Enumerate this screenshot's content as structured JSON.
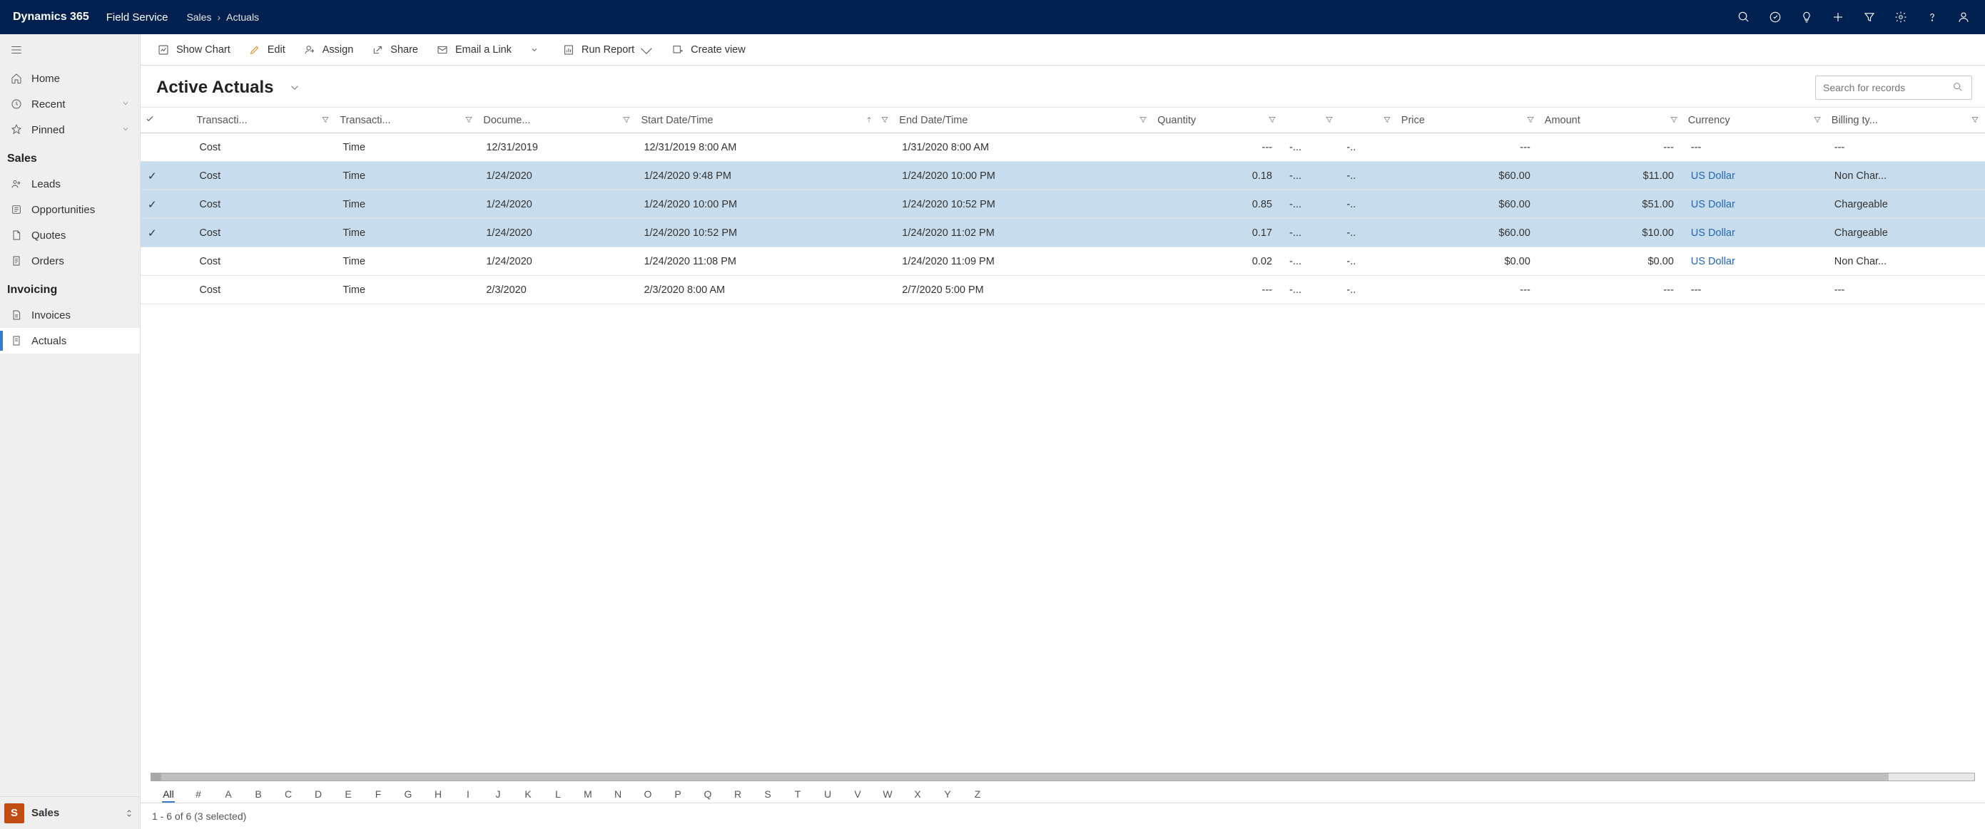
{
  "top": {
    "brand": "Dynamics 365",
    "module": "Field Service",
    "crumb1": "Sales",
    "crumb2": "Actuals"
  },
  "nav": {
    "items": [
      {
        "label": "Home",
        "icon": "home-icon"
      },
      {
        "label": "Recent",
        "icon": "clock-icon",
        "expandable": true
      },
      {
        "label": "Pinned",
        "icon": "pin-icon",
        "expandable": true
      }
    ],
    "section_sales": "Sales",
    "sales_items": [
      {
        "label": "Leads",
        "icon": "leads-icon"
      },
      {
        "label": "Opportunities",
        "icon": "opportunity-icon"
      },
      {
        "label": "Quotes",
        "icon": "quote-icon"
      },
      {
        "label": "Orders",
        "icon": "order-icon"
      }
    ],
    "section_invoicing": "Invoicing",
    "inv_items": [
      {
        "label": "Invoices",
        "icon": "invoice-icon"
      },
      {
        "label": "Actuals",
        "icon": "actuals-icon",
        "active": true
      }
    ],
    "footer_initial": "S",
    "footer_label": "Sales"
  },
  "cmd": {
    "show_chart": "Show Chart",
    "edit": "Edit",
    "assign": "Assign",
    "share": "Share",
    "email_link": "Email a Link",
    "run_report": "Run Report",
    "create_view": "Create view"
  },
  "view": {
    "title": "Active Actuals",
    "search_placeholder": "Search for records"
  },
  "columns": [
    "Transacti...",
    "Transacti...",
    "Docume...",
    "Start Date/Time",
    "End Date/Time",
    "Quantity",
    "",
    "",
    "Price",
    "Amount",
    "Currency",
    "Billing ty..."
  ],
  "rows": [
    {
      "selected": false,
      "c": [
        "Cost",
        "Time",
        "12/31/2019",
        "12/31/2019 8:00 AM",
        "1/31/2020 8:00 AM",
        "---",
        "-...",
        "-..",
        "---",
        "---",
        "---",
        "---"
      ]
    },
    {
      "selected": true,
      "c": [
        "Cost",
        "Time",
        "1/24/2020",
        "1/24/2020 9:48 PM",
        "1/24/2020 10:00 PM",
        "0.18",
        "-...",
        "-..",
        "$60.00",
        "$11.00",
        "US Dollar",
        "Non Char..."
      ]
    },
    {
      "selected": true,
      "c": [
        "Cost",
        "Time",
        "1/24/2020",
        "1/24/2020 10:00 PM",
        "1/24/2020 10:52 PM",
        "0.85",
        "-...",
        "-..",
        "$60.00",
        "$51.00",
        "US Dollar",
        "Chargeable"
      ]
    },
    {
      "selected": true,
      "c": [
        "Cost",
        "Time",
        "1/24/2020",
        "1/24/2020 10:52 PM",
        "1/24/2020 11:02 PM",
        "0.17",
        "-...",
        "-..",
        "$60.00",
        "$10.00",
        "US Dollar",
        "Chargeable"
      ]
    },
    {
      "selected": false,
      "c": [
        "Cost",
        "Time",
        "1/24/2020",
        "1/24/2020 11:08 PM",
        "1/24/2020 11:09 PM",
        "0.02",
        "-...",
        "-..",
        "$0.00",
        "$0.00",
        "US Dollar",
        "Non Char..."
      ]
    },
    {
      "selected": false,
      "c": [
        "Cost",
        "Time",
        "2/3/2020",
        "2/3/2020 8:00 AM",
        "2/7/2020 5:00 PM",
        "---",
        "-...",
        "-..",
        "---",
        "---",
        "---",
        "---"
      ]
    }
  ],
  "alphabar": [
    "All",
    "#",
    "A",
    "B",
    "C",
    "D",
    "E",
    "F",
    "G",
    "H",
    "I",
    "J",
    "K",
    "L",
    "M",
    "N",
    "O",
    "P",
    "Q",
    "R",
    "S",
    "T",
    "U",
    "V",
    "W",
    "X",
    "Y",
    "Z"
  ],
  "status": "1 - 6 of 6 (3 selected)"
}
